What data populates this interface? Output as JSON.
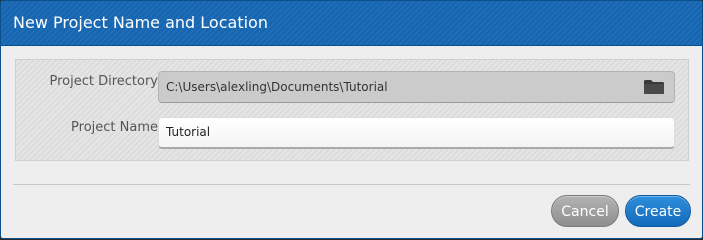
{
  "dialog": {
    "title": "New Project Name and Location",
    "accent_color": "#1766b2"
  },
  "project_directory": {
    "label": "Project Directory",
    "value": "C:\\Users\\alexling\\Documents\\Tutorial",
    "browse_icon": "folder-icon"
  },
  "project_name": {
    "label": "Project Name",
    "value": "Tutorial"
  },
  "buttons": {
    "cancel_label": "Cancel",
    "create_label": "Create"
  }
}
